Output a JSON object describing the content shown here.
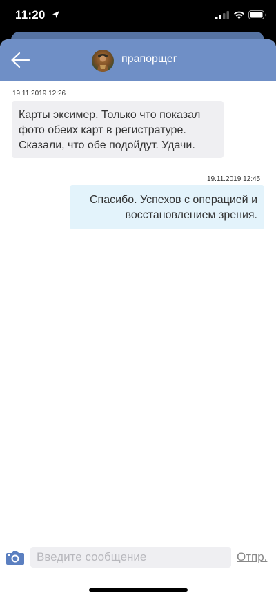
{
  "status_bar": {
    "time": "11:20",
    "icons": [
      "location-arrow-icon",
      "signal-icon",
      "wifi-icon",
      "battery-icon"
    ]
  },
  "header": {
    "title": "прапорщег",
    "back_icon": "back-arrow-icon",
    "avatar": "avatar"
  },
  "colors": {
    "header_bg": "#6f8fc6",
    "incoming_bubble": "#efeff2",
    "outgoing_bubble": "#e3f3fb",
    "send_text": "#888888"
  },
  "messages": [
    {
      "direction": "incoming",
      "time": "19.11.2019 12:26",
      "lines": [
        "Карты эксимер. Только что показал",
        "фото обеих карт в регистратуре.",
        "Сказали, что обе подойдут. Удачи."
      ]
    },
    {
      "direction": "outgoing",
      "time": "19.11.2019 12:45",
      "lines": [
        "Спасибо. Успехов с операцией и",
        "восстановлением зрения."
      ]
    }
  ],
  "composer": {
    "camera_icon": "camera-icon",
    "placeholder": "Введите сообщение",
    "value": "",
    "send_label": "Отпр."
  }
}
